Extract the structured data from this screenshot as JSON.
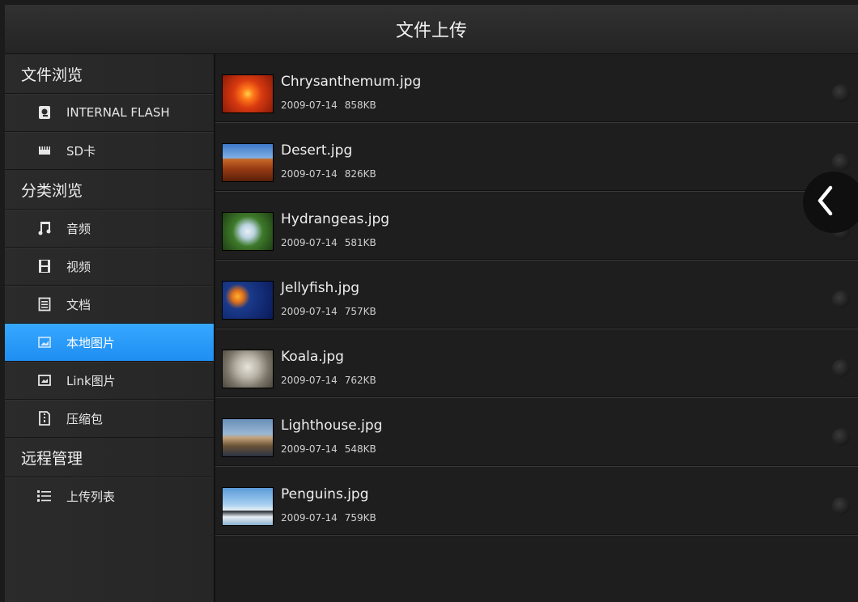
{
  "title": "文件上传",
  "sidebar": {
    "sections": [
      {
        "label": "文件浏览"
      },
      {
        "label": "分类浏览"
      },
      {
        "label": "远程管理"
      }
    ],
    "items": [
      {
        "label": "INTERNAL FLASH",
        "icon": "internal-storage-icon"
      },
      {
        "label": "SD卡",
        "icon": "sd-card-icon"
      },
      {
        "label": "音频",
        "icon": "music-note-icon"
      },
      {
        "label": "视频",
        "icon": "film-icon"
      },
      {
        "label": "文档",
        "icon": "document-icon"
      },
      {
        "label": "本地图片",
        "icon": "image-icon",
        "active": true
      },
      {
        "label": "Link图片",
        "icon": "link-image-icon"
      },
      {
        "label": "压缩包",
        "icon": "archive-icon"
      },
      {
        "label": "上传列表",
        "icon": "list-icon"
      }
    ],
    "active_color": "#2b9bff"
  },
  "files": [
    {
      "name": "Chrysanthemum.jpg",
      "date": "2009-07-14",
      "size": "858KB"
    },
    {
      "name": "Desert.jpg",
      "date": "2009-07-14",
      "size": "826KB"
    },
    {
      "name": "Hydrangeas.jpg",
      "date": "2009-07-14",
      "size": "581KB"
    },
    {
      "name": "Jellyfish.jpg",
      "date": "2009-07-14",
      "size": "757KB"
    },
    {
      "name": "Koala.jpg",
      "date": "2009-07-14",
      "size": "762KB"
    },
    {
      "name": "Lighthouse.jpg",
      "date": "2009-07-14",
      "size": "548KB"
    },
    {
      "name": "Penguins.jpg",
      "date": "2009-07-14",
      "size": "759KB"
    }
  ],
  "collapse_icon": "chevron-left-icon"
}
